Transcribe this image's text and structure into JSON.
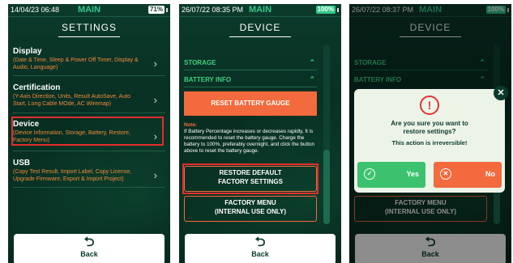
{
  "colors": {
    "accent_green": "#33c98a",
    "highlight_red": "#e32d2d",
    "orange": "#f26a3d",
    "dark_bg": "#062a1f"
  },
  "screen1": {
    "status": {
      "datetime": "14/04/23 06:48",
      "label": "MAIN",
      "battery": "71%"
    },
    "title": "SETTINGS",
    "menu": [
      {
        "title": "Display",
        "desc": "(Date & Time, Sleep & Power Off Timer, Display & Audio, Language)"
      },
      {
        "title": "Certification",
        "desc": "(Y-Axis Direction, Units, Result AutoSave, Auto Start, Long Cable MOde, AC Wiremap)"
      },
      {
        "title": "Device",
        "desc": "(Device Information, Storage, Battery, Restore, Factory Menu)"
      },
      {
        "title": "USB",
        "desc": "(Copy Test Result, Import Label, Copy License, Upgrade Firmware, Export & Import Project)"
      }
    ],
    "back_label": "Back"
  },
  "screen2": {
    "status": {
      "datetime": "26/07/22 08:35 PM",
      "label": "MAIN",
      "battery": "100%"
    },
    "title": "DEVICE",
    "sections": [
      "STORAGE",
      "BATTERY INFO"
    ],
    "reset_button": "RESET BATTERY GAUGE",
    "note_label": "Note:",
    "note_text": "If Battery Percentage increases or decreases rapidly, It is recommended to reset the battery gauge. Charge the battery to 100%, preferably overnight, and click the button above to reset the battery gauge.",
    "restore_line1": "RESTORE DEFAULT",
    "restore_line2": "FACTORY SETTINGS",
    "factory_line1": "FACTORY MENU",
    "factory_line2": "(INTERNAL USE ONLY)",
    "back_label": "Back"
  },
  "screen3": {
    "status": {
      "datetime": "26/07/22 08:37 PM",
      "label": "MAIN",
      "battery": "100%"
    },
    "title": "DEVICE",
    "sections": [
      "STORAGE",
      "BATTERY INFO"
    ],
    "factory_line1": "FACTORY MENU",
    "factory_line2": "(INTERNAL USE ONLY)",
    "dialog": {
      "question_line1": "Are you sure you want to",
      "question_line2": "restore settings?",
      "warning": "This action is irreversible!",
      "yes_label": "Yes",
      "no_label": "No"
    },
    "back_label": "Back"
  },
  "icons": [
    "chevron-right-icon",
    "back-arrow-icon",
    "close-icon",
    "warning-icon",
    "check-icon",
    "cancel-icon",
    "battery-icon",
    "chevron-up-icon"
  ]
}
